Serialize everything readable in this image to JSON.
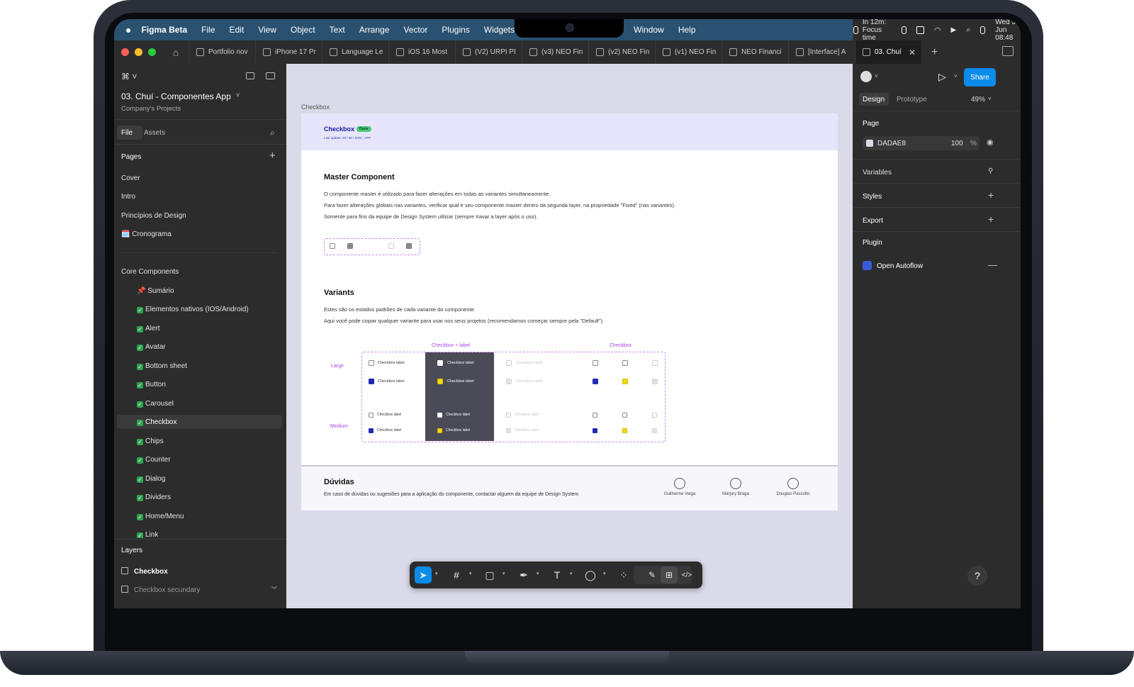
{
  "menubar": {
    "app_name": "Figma Beta",
    "menus": [
      "File",
      "Edit",
      "View",
      "Object",
      "Text",
      "Arrange",
      "Vector",
      "Plugins",
      "Widgets"
    ],
    "menus_right": [
      "Window",
      "Help"
    ],
    "focus": "In 12m: Focus time",
    "datetime": "Wed 3 Jun  08:48"
  },
  "tabs": [
    {
      "label": "Portfolio nov"
    },
    {
      "label": "iPhone 17 Pr"
    },
    {
      "label": "Language Le"
    },
    {
      "label": "iOS 16 Most"
    },
    {
      "label": "(V2) URPI PI"
    },
    {
      "label": "(v3) NEO Fin"
    },
    {
      "label": "(v2) NEO Fin"
    },
    {
      "label": "(v1) NEO Fin"
    },
    {
      "label": "NEO Financi"
    },
    {
      "label": "[Interface] A"
    },
    {
      "label": "03. Chuí",
      "active": true
    }
  ],
  "left": {
    "project_title": "03. Chuí - Componentes App",
    "project_sub": "Company's Projects",
    "tab_file": "File",
    "tab_assets": "Assets",
    "pages_header": "Pages",
    "pages": [
      "Cover",
      "Intro",
      "Princípios de Design",
      "🗓️ Cronograma"
    ],
    "core_header": "Core Components",
    "core_first": "📌 Sumário",
    "core_items": [
      "Elementos nativos (IOS/Android)",
      "Alert",
      "Avatar",
      "Bottom sheet",
      "Button",
      "Carousel",
      "Checkbox",
      "Chips",
      "Counter",
      "Dialog",
      "Dividers",
      "Home/Menu",
      "Link"
    ],
    "layers_header": "Layers",
    "layers": [
      "Checkbox",
      "Checkbox secundary"
    ]
  },
  "canvas": {
    "frame_label": "Checkbox",
    "header_title": "Checkbox",
    "header_badge": "Done",
    "header_sub": "Last update: 29 / 06 / 2022 - APP",
    "master_title": "Master Component",
    "master_lines": [
      "O componente master é utilizado para fazer alterações em todas as variantes simultaneamente.",
      "Para fazer alterações globais nas variantes, verificar qual é seu componente master dentro da segunda layer, na propriedade  \"Fixed\" (nas variantes).",
      "Somente para fins da equipe de Design System utilizar (sempre travar a layer após o uso)."
    ],
    "variants_title": "Variants",
    "variants_lines": [
      "Estes são os estados padrões de cada variante do componente.",
      "Aqui você pode copiar qualquer variante para usar nos seus projetos (recomendamos começar sempre pela \"Default\")."
    ],
    "col_label_1": "Checkbox + label",
    "col_label_2": "Checkbox",
    "row_large": "Large",
    "row_medium": "Medium",
    "checkbox_label": "Checkbox label",
    "doubts_title": "Dúvidas",
    "doubts_text": "Em caso de dúvidas ou sugestões para a aplicação do componente, contactar alguem da equipe de Design System",
    "people": [
      "Guilherme Veiga",
      "Marjory Braga",
      "Douglas Pascotto"
    ]
  },
  "right": {
    "share": "Share",
    "tab_design": "Design",
    "tab_prototype": "Prototype",
    "zoom": "49%",
    "page_header": "Page",
    "page_color": "DADAE8",
    "page_opacity": "100",
    "percent": "%",
    "variables": "Variables",
    "styles": "Styles",
    "export": "Export",
    "plugin": "Plugin",
    "plugin_item": "Open Autoflow",
    "help": "?"
  },
  "colors": {
    "accent": "#0c8ce9",
    "canvas_bg": "#dadae8",
    "brand_blue": "#1f2bb3",
    "highlight_yellow": "#f1da0b",
    "variant_purple": "#a844e0"
  }
}
